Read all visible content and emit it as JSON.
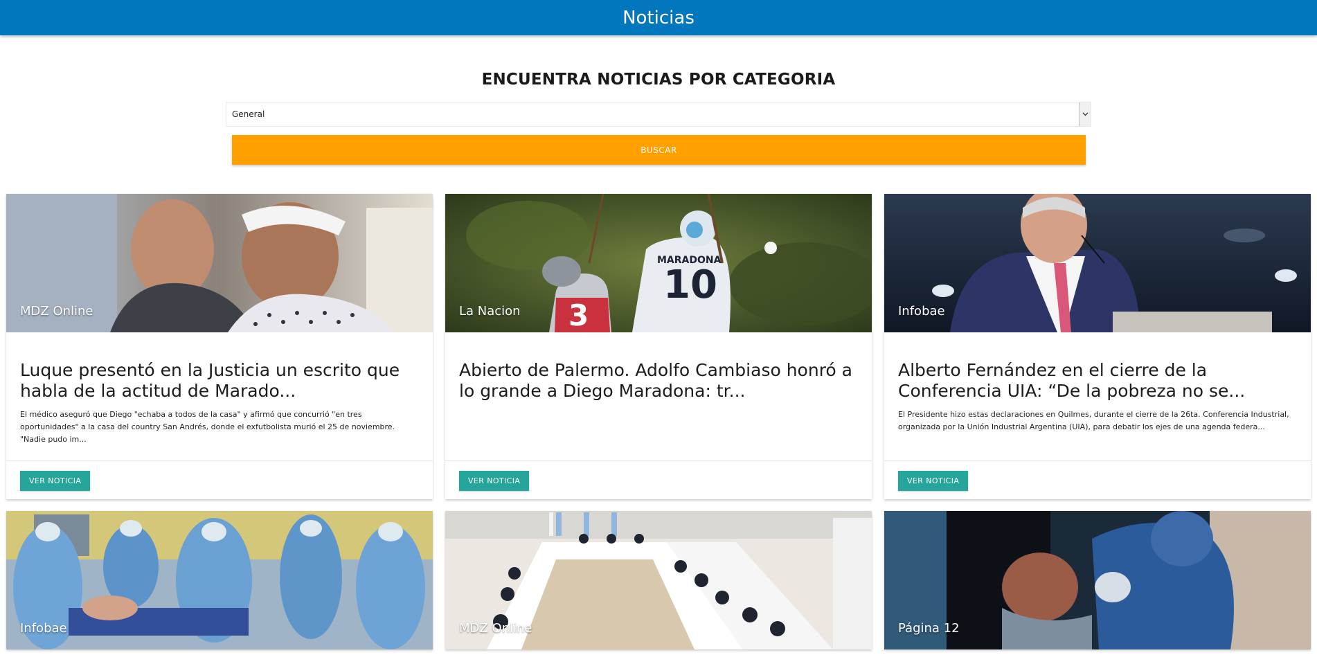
{
  "header": {
    "title": "Noticias"
  },
  "search": {
    "heading": "ENCUENTRA NOTICIAS POR CATEGORIA",
    "selected_category": "General",
    "button_label": "BUSCAR"
  },
  "colors": {
    "app_bar": "#0277bd",
    "search_button": "#ffa000",
    "action_button": "#26a69a"
  },
  "news": [
    {
      "source": "MDZ Online",
      "title": "Luque presentó en la Justicia un escrito que habla de la actitud de Marado...",
      "description": "El médico aseguró que Diego \"echaba a todos de la casa\" y afirmó que concurrió \"en tres oportunidades\" a la casa del country San Andrés, donde el exfutbolista murió el 25 de noviembre. \"Nadie pudo im...",
      "button_label": "VER NOTICIA"
    },
    {
      "source": "La Nacion",
      "title": "Abierto de Palermo. Adolfo Cambiaso honró a lo grande a Diego Maradona: tr...",
      "description": "",
      "button_label": "VER NOTICIA"
    },
    {
      "source": "Infobae",
      "title": "Alberto Fernández en el cierre de la Conferencia UIA: “De la pobreza no se...",
      "description": "El Presidente hizo estas declaraciones en Quilmes, durante el cierre de la 26ta. Conferencia Industrial, organizada por la Unión Industrial Argentina (UIA), para debatir los ejes de una agenda federa...",
      "button_label": "VER NOTICIA"
    },
    {
      "source": "Infobae"
    },
    {
      "source": "MDZ Online"
    },
    {
      "source": "Página 12"
    }
  ]
}
